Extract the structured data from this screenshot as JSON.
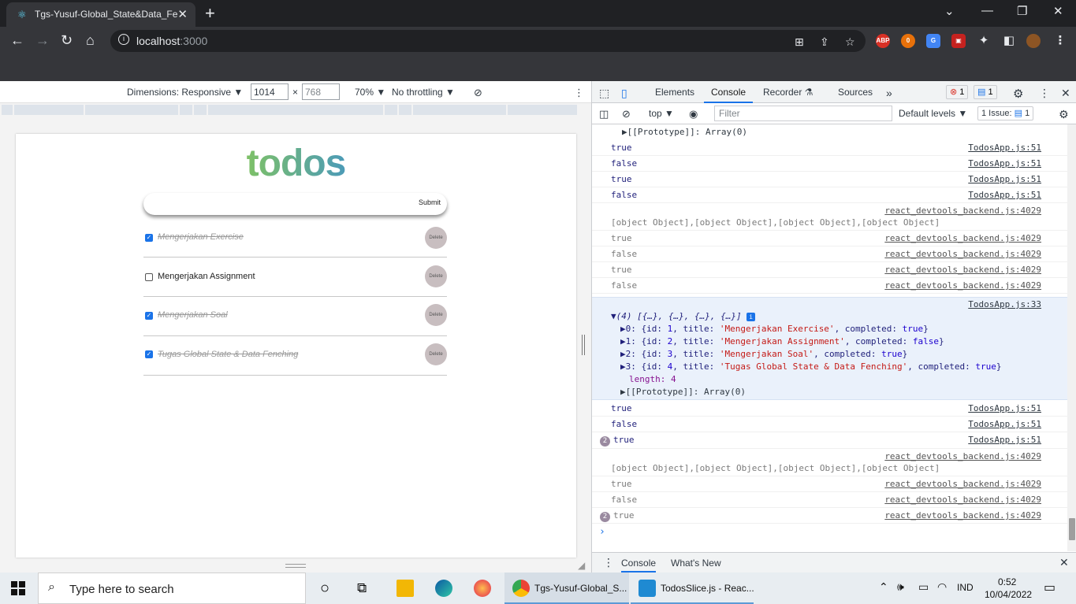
{
  "browser": {
    "tab_title": "Tgs-Yusuf-Global_State&Data_Fe",
    "address_host": "localhost",
    "address_port": ":3000"
  },
  "device_toolbar": {
    "dimensions_label": "Dimensions: Responsive",
    "width": "1014",
    "times": "×",
    "height": "768",
    "zoom": "70%",
    "throttling": "No throttling"
  },
  "app": {
    "title": "todos",
    "input_placeholder": "",
    "submit_label": "Submit",
    "delete_label": "Delete",
    "todos": [
      {
        "title": "Mengerjakan Exercise",
        "completed": true
      },
      {
        "title": "Mengerjakan Assignment",
        "completed": false
      },
      {
        "title": "Mengerjakan Soal",
        "completed": true
      },
      {
        "title": "Tugas Global State & Data Fenching",
        "completed": true
      }
    ]
  },
  "devtools": {
    "tabs": [
      "Elements",
      "Console",
      "Recorder",
      "Sources"
    ],
    "active_tab": "Console",
    "error_count": "1",
    "message_count": "1",
    "context": "top",
    "filter_placeholder": "Filter",
    "levels": "Default levels",
    "issues": "1 Issue:",
    "issues_count": "1",
    "drawer_tabs": [
      "Console",
      "What's New"
    ]
  },
  "console": {
    "prototype_line": "[[Prototype]]: Array(0)",
    "lines_a": [
      {
        "msg": "true",
        "src": "TodosApp.js:51"
      },
      {
        "msg": "false",
        "src": "TodosApp.js:51"
      },
      {
        "msg": "true",
        "src": "TodosApp.js:51"
      },
      {
        "msg": "false",
        "src": "TodosApp.js:51"
      }
    ],
    "objects_src": "react_devtools_backend.js:4029",
    "objects_msg": "[object Object],[object Object],[object Object],[object Object]",
    "lines_b": [
      {
        "msg": "true",
        "src": "react_devtools_backend.js:4029"
      },
      {
        "msg": "false",
        "src": "react_devtools_backend.js:4029"
      },
      {
        "msg": "true",
        "src": "react_devtools_backend.js:4029"
      },
      {
        "msg": "false",
        "src": "react_devtools_backend.js:4029"
      }
    ],
    "array_src": "TodosApp.js:33",
    "array_header": "▼(4) [{…}, {…}, {…}, {…}]",
    "array_items": [
      {
        "idx": "▶0:",
        "id": "1",
        "title": "'Mengerjakan Exercise'",
        "completed": "true"
      },
      {
        "idx": "▶1:",
        "id": "2",
        "title": "'Mengerjakan Assignment'",
        "completed": "false"
      },
      {
        "idx": "▶2:",
        "id": "3",
        "title": "'Mengerjakan Soal'",
        "completed": "true"
      },
      {
        "idx": "▶3:",
        "id": "4",
        "title": "'Tugas Global State & Data Fenching'",
        "completed": "true"
      }
    ],
    "length_line": "length: 4",
    "array_proto": "▶[[Prototype]]: Array(0)",
    "lines_c": [
      {
        "msg": "true",
        "src": "TodosApp.js:51"
      },
      {
        "msg": "false",
        "src": "TodosApp.js:51"
      },
      {
        "msg": "true",
        "src": "TodosApp.js:51",
        "count": "2"
      }
    ],
    "objects_src_2": "react_devtools_backend.js:4029",
    "objects_msg_2": "[object Object],[object Object],[object Object],[object Object]",
    "lines_d": [
      {
        "msg": "true",
        "src": "react_devtools_backend.js:4029"
      },
      {
        "msg": "false",
        "src": "react_devtools_backend.js:4029"
      },
      {
        "msg": "true",
        "src": "react_devtools_backend.js:4029",
        "count": "2"
      }
    ],
    "prompt": "›"
  },
  "taskbar": {
    "search_text": "Type here to search",
    "apps": [
      {
        "label": "Tgs-Yusuf-Global_S..."
      },
      {
        "label": "TodosSlice.js - Reac..."
      }
    ],
    "language": "IND",
    "time": "0:52",
    "date": "10/04/2022"
  },
  "colors": {
    "chrome_dark": "#202124",
    "chrome_toolbar": "#35363a",
    "accent_blue": "#1a73e8",
    "todo_gradient_start": "#a8d53a",
    "todo_gradient_end": "#1fb4e6"
  }
}
